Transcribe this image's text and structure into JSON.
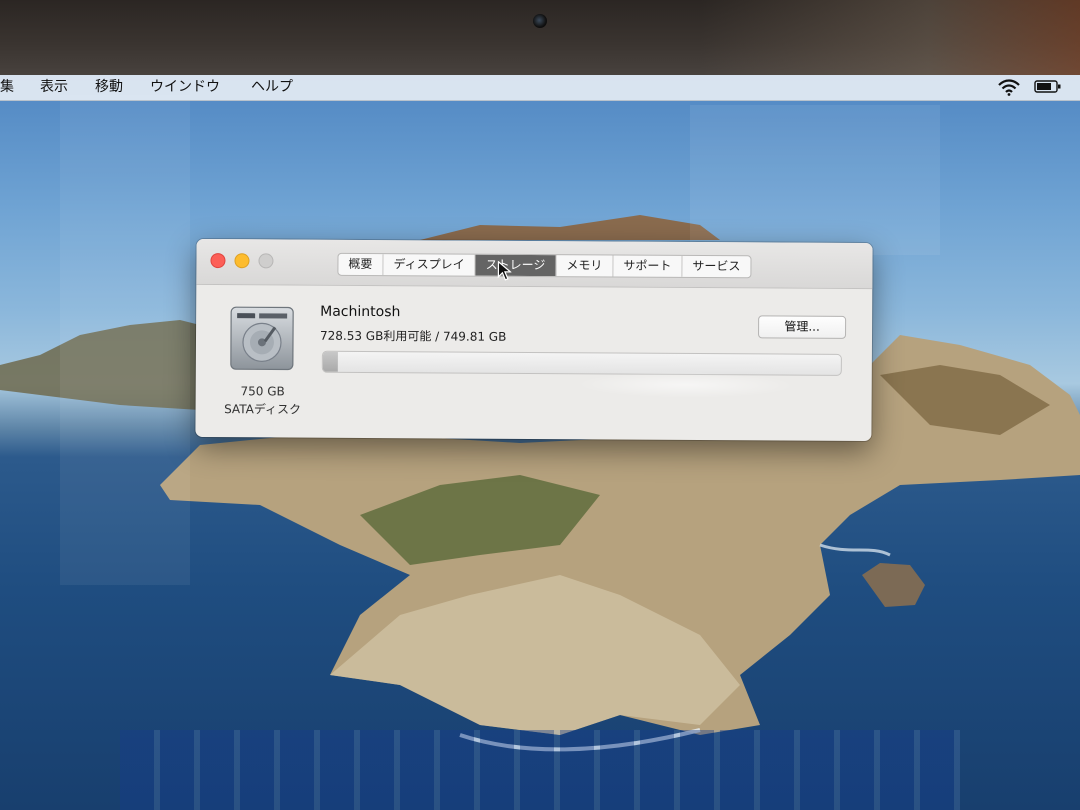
{
  "menubar": {
    "items": [
      "集",
      "表示",
      "移動",
      "ウインドウ",
      "ヘルプ"
    ]
  },
  "window": {
    "tabs": [
      {
        "label": "概要",
        "active": false
      },
      {
        "label": "ディスプレイ",
        "active": false
      },
      {
        "label": "ストレージ",
        "active": true
      },
      {
        "label": "メモリ",
        "active": false
      },
      {
        "label": "サポート",
        "active": false
      },
      {
        "label": "サービス",
        "active": false
      }
    ],
    "disk": {
      "capacity": "750 GB",
      "type": "SATAディスク"
    },
    "volume": {
      "name": "Machintosh",
      "info": "728.53 GB利用可能 / 749.81 GB",
      "used_fraction": 0.029
    },
    "manage_button": "管理..."
  },
  "icons": [
    "wifi-icon",
    "battery-icon",
    "hard-disk-icon",
    "arrow-cursor-icon"
  ],
  "colors": {
    "close": "#fc5f57",
    "minimize": "#fdbc2e",
    "active_tab": "#646464"
  }
}
